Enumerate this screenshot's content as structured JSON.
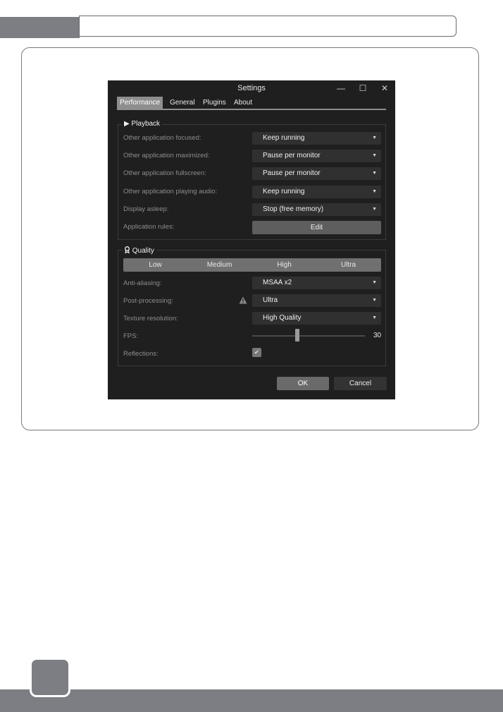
{
  "window": {
    "title": "Settings",
    "controls": {
      "minimize": "—",
      "maximize": "☐",
      "close": "✕"
    }
  },
  "tabs": [
    {
      "label": "Performance",
      "active": true
    },
    {
      "label": "General",
      "active": false
    },
    {
      "label": "Plugins",
      "active": false
    },
    {
      "label": "About",
      "active": false
    }
  ],
  "playback": {
    "title": "Playback",
    "icon": "play-icon",
    "rows": [
      {
        "label": "Other application focused:",
        "value": "Keep running"
      },
      {
        "label": "Other application maximized:",
        "value": "Pause per monitor"
      },
      {
        "label": "Other application fullscreen:",
        "value": "Pause per monitor"
      },
      {
        "label": "Other application playing audio:",
        "value": "Keep running"
      },
      {
        "label": "Display asleep:",
        "value": "Stop (free memory)"
      }
    ],
    "rules_label": "Application rules:",
    "edit_label": "Edit"
  },
  "quality": {
    "title": "Quality",
    "icon": "award-icon",
    "presets": [
      "Low",
      "Medium",
      "High",
      "Ultra"
    ],
    "antialiasing_label": "Anti-aliasing:",
    "antialiasing_value": "MSAA x2",
    "postprocessing_label": "Post-processing:",
    "postprocessing_value": "Ultra",
    "texture_label": "Texture resolution:",
    "texture_value": "High Quality",
    "fps_label": "FPS:",
    "fps_value": "30",
    "fps_slider_fraction": 0.4,
    "reflections_label": "Reflections:",
    "reflections_checked": true
  },
  "buttons": {
    "ok": "OK",
    "cancel": "Cancel"
  },
  "colors": {
    "window_bg": "#1f1f1f",
    "accent": "#8e8e8e",
    "page_bar": "#7d7e84"
  }
}
